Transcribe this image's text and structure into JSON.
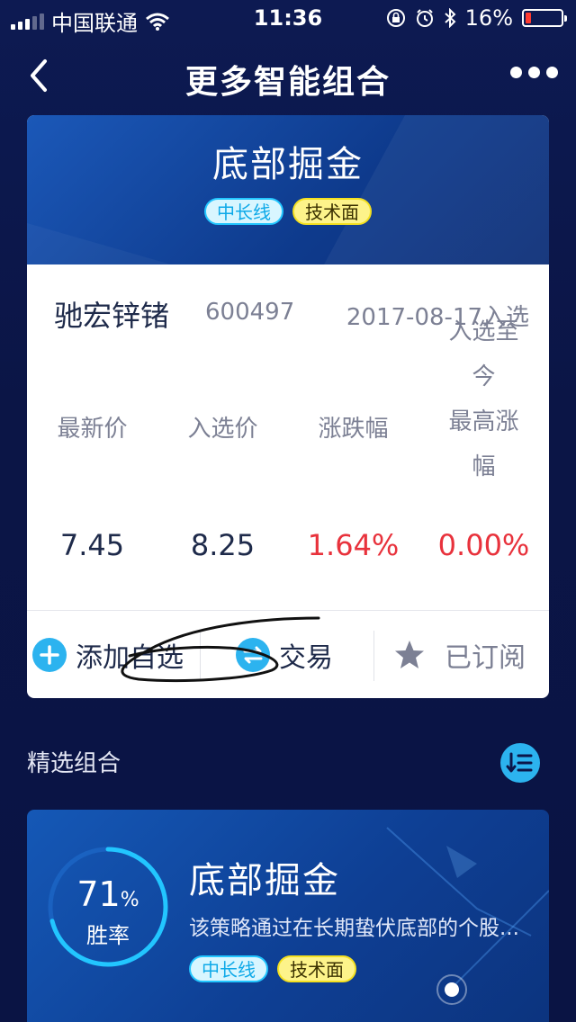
{
  "status_bar": {
    "carrier": "中国联通",
    "time": "11:36",
    "battery": "16%",
    "battery_level": 0.16
  },
  "nav": {
    "title": "更多智能组合"
  },
  "featured": {
    "name": "底部掘金",
    "tags": [
      "中长线",
      "技术面"
    ],
    "stock": {
      "name": "驰宏锌锗",
      "code": "600497",
      "date": "2017-08-17入选"
    },
    "columns": [
      {
        "label": "最新价",
        "value": "7.45"
      },
      {
        "label": "入选价",
        "value": "8.25"
      },
      {
        "label": "涨跌幅",
        "value": "1.64%"
      },
      {
        "label_lines": [
          "入选至",
          "今",
          "最高涨",
          "幅"
        ],
        "value": "0.00%"
      }
    ],
    "actions": {
      "add": "添加自选",
      "trade": "交易",
      "subscribed": "已订阅"
    }
  },
  "section": {
    "title": "精选组合"
  },
  "portfolio": {
    "win_rate_value": "71",
    "win_rate_unit": "%",
    "win_rate_fraction": 0.71,
    "win_rate_label": "胜率",
    "name": "底部掘金",
    "description": "该策略通过在长期蛰伏底部的个股...",
    "tags": [
      "中长线",
      "技术面"
    ]
  },
  "colors": {
    "accent_blue": "#2cb3ef",
    "red": "#e8323c",
    "tag_cyan": "#22c6ff",
    "tag_yellow": "#fdf38a"
  }
}
